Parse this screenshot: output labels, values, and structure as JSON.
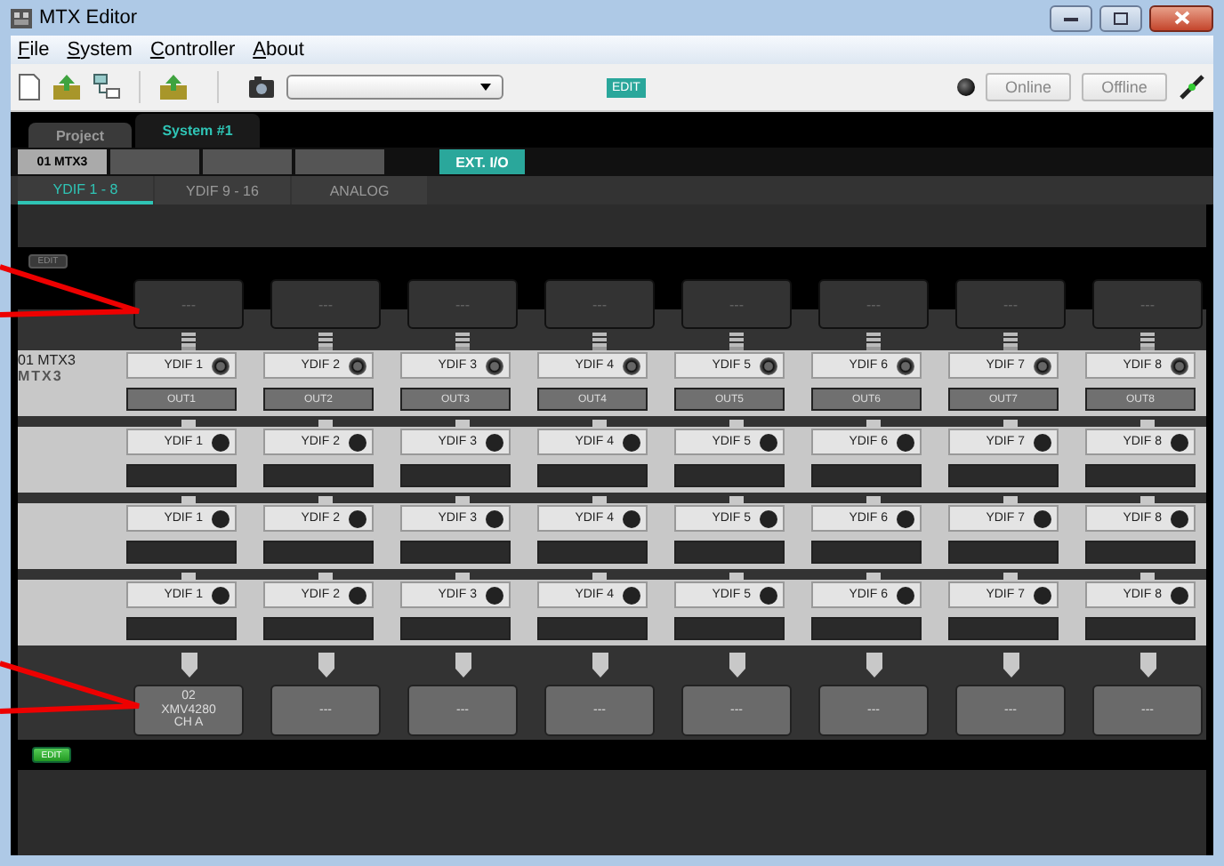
{
  "window": {
    "title": "MTX Editor"
  },
  "menu": [
    {
      "label": "File"
    },
    {
      "label": "System"
    },
    {
      "label": "Controller"
    },
    {
      "label": "About"
    }
  ],
  "toolbar": {
    "edit_badge": "EDIT",
    "status_online": false,
    "online_button": "Online",
    "offline_button": "Offline"
  },
  "tabs": [
    {
      "label": "Project",
      "selected": false
    },
    {
      "label": "System #1",
      "selected": true
    }
  ],
  "devices": [
    {
      "label": "01 MTX3",
      "selected": true
    }
  ],
  "ext_io": {
    "label": "EXT. I/O",
    "selected": true
  },
  "subtabs": [
    {
      "label": "YDIF 1 - 8",
      "selected": true
    },
    {
      "label": "YDIF 9 - 16",
      "selected": false
    },
    {
      "label": "ANALOG",
      "selected": false
    }
  ],
  "panel": {
    "top_edit": "EDIT",
    "sources": [
      "---",
      "---",
      "---",
      "---",
      "---",
      "---",
      "---",
      "---"
    ],
    "device": {
      "name": "01 MTX3",
      "model": "MTX3"
    },
    "groups": [
      {
        "ports": [
          {
            "label": "YDIF 1",
            "active": true,
            "output": "OUT1"
          },
          {
            "label": "YDIF 2",
            "active": true,
            "output": "OUT2"
          },
          {
            "label": "YDIF 3",
            "active": true,
            "output": "OUT3"
          },
          {
            "label": "YDIF 4",
            "active": true,
            "output": "OUT4"
          },
          {
            "label": "YDIF 5",
            "active": true,
            "output": "OUT5"
          },
          {
            "label": "YDIF 6",
            "active": true,
            "output": "OUT6"
          },
          {
            "label": "YDIF 7",
            "active": true,
            "output": "OUT7"
          },
          {
            "label": "YDIF 8",
            "active": true,
            "output": "OUT8"
          }
        ]
      },
      {
        "ports": [
          {
            "label": "YDIF 1",
            "active": false
          },
          {
            "label": "YDIF 2",
            "active": false
          },
          {
            "label": "YDIF 3",
            "active": false
          },
          {
            "label": "YDIF 4",
            "active": false
          },
          {
            "label": "YDIF 5",
            "active": false
          },
          {
            "label": "YDIF 6",
            "active": false
          },
          {
            "label": "YDIF 7",
            "active": false
          },
          {
            "label": "YDIF 8",
            "active": false
          }
        ]
      },
      {
        "ports": [
          {
            "label": "YDIF 1",
            "active": false
          },
          {
            "label": "YDIF 2",
            "active": false
          },
          {
            "label": "YDIF 3",
            "active": false
          },
          {
            "label": "YDIF 4",
            "active": false
          },
          {
            "label": "YDIF 5",
            "active": false
          },
          {
            "label": "YDIF 6",
            "active": false
          },
          {
            "label": "YDIF 7",
            "active": false
          },
          {
            "label": "YDIF 8",
            "active": false
          }
        ]
      },
      {
        "ports": [
          {
            "label": "YDIF 1",
            "active": false
          },
          {
            "label": "YDIF 2",
            "active": false
          },
          {
            "label": "YDIF 3",
            "active": false
          },
          {
            "label": "YDIF 4",
            "active": false
          },
          {
            "label": "YDIF 5",
            "active": false
          },
          {
            "label": "YDIF 6",
            "active": false
          },
          {
            "label": "YDIF 7",
            "active": false
          },
          {
            "label": "YDIF 8",
            "active": false
          }
        ]
      }
    ],
    "destinations": [
      {
        "lines": [
          "02",
          "XMV4280",
          "CH A"
        ]
      },
      {
        "lines": [
          "---"
        ]
      },
      {
        "lines": [
          "---"
        ]
      },
      {
        "lines": [
          "---"
        ]
      },
      {
        "lines": [
          "---"
        ]
      },
      {
        "lines": [
          "---"
        ]
      },
      {
        "lines": [
          "---"
        ]
      },
      {
        "lines": [
          "---"
        ]
      }
    ],
    "bottom_edit": "EDIT"
  }
}
